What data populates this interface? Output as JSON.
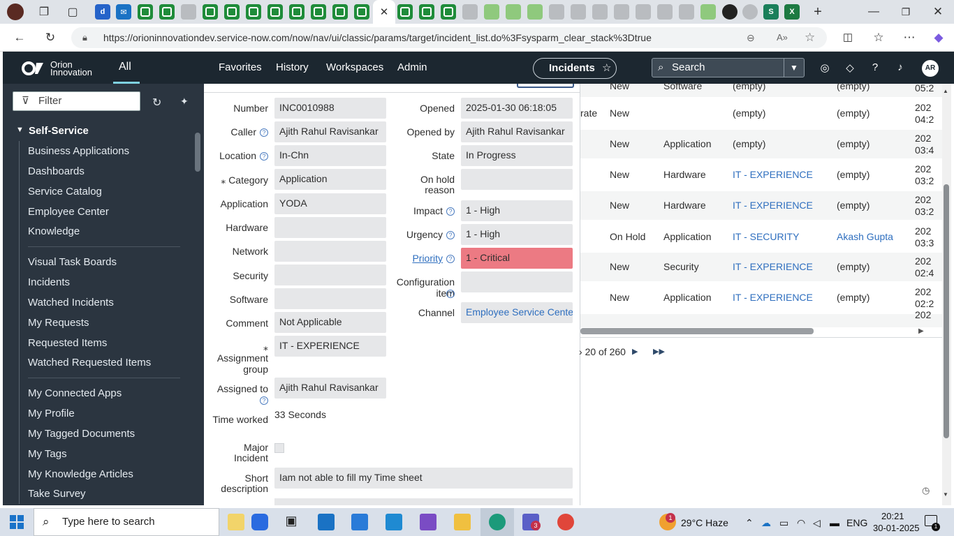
{
  "browser": {
    "url": "https://orioninnovationdev.service-now.com/now/nav/ui/classic/params/target/incident_list.do%3Fsysparm_clear_stack%3Dtrue",
    "active_tab_close": "✕"
  },
  "header": {
    "logo_line1": "Orion",
    "logo_line2": "Innovation",
    "all": "All",
    "nav": [
      "Favorites",
      "History",
      "Workspaces",
      "Admin"
    ],
    "context_pill": "Incidents",
    "search_placeholder": "Search",
    "avatar": "AR"
  },
  "sidebar": {
    "filter_placeholder": "Filter",
    "section": "Self-Service",
    "group1": [
      "Business Applications",
      "Dashboards",
      "Service Catalog",
      "Employee Center",
      "Knowledge"
    ],
    "group2": [
      "Visual Task Boards",
      "Incidents",
      "Watched Incidents",
      "My Requests",
      "Requested Items",
      "Watched Requested Items"
    ],
    "group3": [
      "My Connected Apps",
      "My Profile",
      "My Tagged Documents",
      "My Tags",
      "My Knowledge Articles",
      "Take Survey"
    ]
  },
  "form": {
    "left": [
      {
        "label": "Number",
        "value": "INC0010988"
      },
      {
        "label": "Caller",
        "value": "Ajith Rahul Ravisankar"
      },
      {
        "label": "Location",
        "value": "In-Chn"
      },
      {
        "label": "Category",
        "value": "Application"
      },
      {
        "label": "Application",
        "value": "YODA"
      },
      {
        "label": "Hardware",
        "value": ""
      },
      {
        "label": "Network",
        "value": ""
      },
      {
        "label": "Security",
        "value": ""
      },
      {
        "label": "Software",
        "value": ""
      },
      {
        "label": "Comment",
        "value": "Not Applicable"
      }
    ],
    "assignment_group_label": "Assignment group",
    "assignment_group": "IT - EXPERIENCE",
    "assigned_to_label": "Assigned to",
    "assigned_to": "Ajith Rahul Ravisankar",
    "time_worked_label": "Time worked",
    "time_worked": "33 Seconds",
    "major_incident_label": "Major Incident",
    "short_description_label": "Short description",
    "short_description": "Iam not able to fill my Time sheet",
    "right": [
      {
        "label": "Opened",
        "value": "2025-01-30 06:18:05"
      },
      {
        "label": "Opened by",
        "value": "Ajith Rahul Ravisankar"
      },
      {
        "label": "State",
        "value": "In Progress"
      },
      {
        "label": "On hold reason",
        "value": ""
      },
      {
        "label": "Impact",
        "value": "1 - High"
      },
      {
        "label": "Urgency",
        "value": "1 - High"
      },
      {
        "label": "Priority",
        "value": "1 - Critical"
      },
      {
        "label": "Configuration item",
        "value": ""
      },
      {
        "label": "Channel",
        "value": "Employee Service Center"
      }
    ],
    "priority_color": "#ec7a83"
  },
  "list": {
    "rows": [
      {
        "c0": "",
        "state": "New",
        "cat": "Software",
        "group": "(empty)",
        "assigned": "(empty)",
        "date": "05:2"
      },
      {
        "c0": "rate",
        "state": "New",
        "cat": "",
        "group": "(empty)",
        "assigned": "(empty)",
        "date": "202 04:2"
      },
      {
        "c0": "",
        "state": "New",
        "cat": "Application",
        "group": "(empty)",
        "assigned": "(empty)",
        "date": "202 03:4"
      },
      {
        "c0": "",
        "state": "New",
        "cat": "Hardware",
        "group": "IT - EXPERIENCE",
        "assigned": "(empty)",
        "date": "202 03:2"
      },
      {
        "c0": "",
        "state": "New",
        "cat": "Hardware",
        "group": "IT - EXPERIENCE",
        "assigned": "(empty)",
        "date": "202 03:2"
      },
      {
        "c0": "",
        "state": "On Hold",
        "cat": "Application",
        "group": "IT - SECURITY",
        "assigned": "Akash Gupta",
        "date": "202 03:3"
      },
      {
        "c0": "",
        "state": "New",
        "cat": "Security",
        "group": "IT - EXPERIENCE",
        "assigned": "(empty)",
        "date": "202 02:4"
      },
      {
        "c0": "",
        "state": "New",
        "cat": "Application",
        "group": "IT - EXPERIENCE",
        "assigned": "(empty)",
        "date": "202 02:2"
      },
      {
        "c0": "",
        "state": "",
        "cat": "",
        "group": "",
        "assigned": "",
        "date": "202"
      }
    ],
    "pagination": "20 of 260"
  },
  "taskbar": {
    "search_placeholder": "Type here to search",
    "weather": "29°C  Haze",
    "lang": "ENG",
    "time": "20:21",
    "date": "30-01-2025",
    "notif_count": "1",
    "teams_badge": "3",
    "weather_badge": "1"
  }
}
